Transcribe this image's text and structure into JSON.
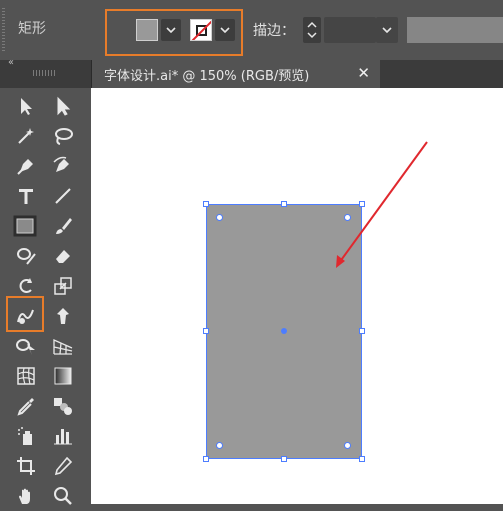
{
  "control_bar": {
    "tool_title": "矩形",
    "fill_color": "#999999",
    "stroke_color": "none",
    "stroke_label": "描边：",
    "highlight_color": "#e77c2a"
  },
  "document_tab": {
    "title": "字体设计.ai* @ 150% (RGB/预览)",
    "close_glyph": "✕"
  },
  "toolbar": {
    "collapse_glyph": "‹‹",
    "tools": [
      "selection-tool",
      "direct-selection-tool",
      "magic-wand-tool",
      "lasso-tool",
      "pen-tool",
      "curvature-tool",
      "type-tool",
      "line-segment-tool",
      "rectangle-tool",
      "paintbrush-tool",
      "shaper-tool",
      "eraser-tool",
      "rotate-tool",
      "scale-tool",
      "warp-tool",
      "free-transform-tool",
      "shape-builder-tool",
      "perspective-grid-tool",
      "mesh-tool",
      "gradient-tool",
      "eyedropper-tool",
      "blend-tool",
      "symbol-sprayer-tool",
      "column-graph-tool",
      "artboard-tool",
      "slice-tool",
      "hand-tool",
      "zoom-tool"
    ],
    "active_tool": "rectangle-tool"
  },
  "canvas": {
    "object_fill": "#999999",
    "selection_color": "#4d7dff",
    "annotation_arrow_color": "#e0282e"
  }
}
